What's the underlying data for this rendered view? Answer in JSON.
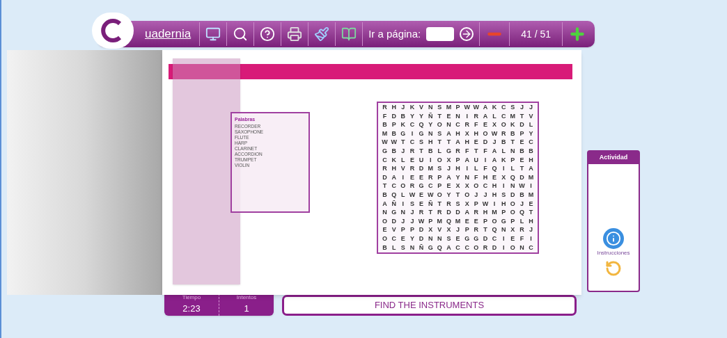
{
  "toolbar": {
    "logo": "uadernia",
    "goto_label": "Ir a página:",
    "page_indicator": "41 / 51"
  },
  "words_panel": {
    "title": "Palabras",
    "words": [
      "RECORDER",
      "SAXOPHONE",
      "FLUTE",
      "HARP",
      "CLARINET",
      "ACCORDION",
      "TRUMPET",
      "VIOLIN"
    ]
  },
  "grid": [
    [
      "R",
      "H",
      "J",
      "K",
      "V",
      "N",
      "S",
      "M",
      "P",
      "W",
      "W",
      "A",
      "K",
      "C",
      "S",
      "J",
      "J"
    ],
    [
      "F",
      "D",
      "B",
      "Y",
      "Y",
      "Ñ",
      "T",
      "E",
      "N",
      "I",
      "R",
      "A",
      "L",
      "C",
      "M",
      "T",
      "V"
    ],
    [
      "B",
      "P",
      "K",
      "C",
      "Q",
      "Y",
      "O",
      "N",
      "C",
      "R",
      "F",
      "E",
      "X",
      "O",
      "K",
      "D",
      "L"
    ],
    [
      "M",
      "B",
      "G",
      "I",
      "G",
      "N",
      "S",
      "A",
      "H",
      "X",
      "H",
      "O",
      "W",
      "R",
      "B",
      "P",
      "Y"
    ],
    [
      "W",
      "W",
      "T",
      "C",
      "S",
      "H",
      "T",
      "T",
      "A",
      "H",
      "E",
      "D",
      "J",
      "B",
      "T",
      "E",
      "C"
    ],
    [
      "G",
      "B",
      "J",
      "R",
      "T",
      "B",
      "L",
      "G",
      "R",
      "F",
      "T",
      "F",
      "A",
      "L",
      "N",
      "B",
      "B"
    ],
    [
      "C",
      "K",
      "L",
      "E",
      "U",
      "I",
      "O",
      "X",
      "P",
      "A",
      "U",
      "I",
      "A",
      "K",
      "P",
      "E",
      "H"
    ],
    [
      "R",
      "H",
      "V",
      "R",
      "D",
      "M",
      "S",
      "J",
      "H",
      "I",
      "L",
      "F",
      "Q",
      "I",
      "L",
      "T",
      "A"
    ],
    [
      "D",
      "A",
      "I",
      "E",
      "E",
      "R",
      "P",
      "A",
      "Y",
      "N",
      "F",
      "H",
      "E",
      "X",
      "Q",
      "D",
      "M"
    ],
    [
      "T",
      "C",
      "O",
      "R",
      "G",
      "C",
      "P",
      "E",
      "X",
      "X",
      "O",
      "C",
      "H",
      "I",
      "N",
      "W",
      "I"
    ],
    [
      "B",
      "Q",
      "L",
      "W",
      "E",
      "W",
      "O",
      "Y",
      "T",
      "O",
      "J",
      "J",
      "H",
      "S",
      "D",
      "B",
      "M"
    ],
    [
      "A",
      "Ñ",
      "I",
      "S",
      "E",
      "Ñ",
      "T",
      "R",
      "S",
      "X",
      "P",
      "W",
      "I",
      "H",
      "O",
      "J",
      "E"
    ],
    [
      "N",
      "G",
      "N",
      "J",
      "R",
      "T",
      "R",
      "D",
      "D",
      "A",
      "R",
      "H",
      "M",
      "P",
      "O",
      "Q",
      "T"
    ],
    [
      "O",
      "D",
      "J",
      "J",
      "W",
      "P",
      "M",
      "Q",
      "M",
      "E",
      "E",
      "P",
      "O",
      "G",
      "P",
      "L",
      "H"
    ],
    [
      "E",
      "V",
      "P",
      "P",
      "D",
      "X",
      "V",
      "X",
      "J",
      "P",
      "R",
      "T",
      "Q",
      "N",
      "X",
      "R",
      "J"
    ],
    [
      "O",
      "C",
      "E",
      "Y",
      "D",
      "N",
      "N",
      "S",
      "E",
      "G",
      "G",
      "D",
      "C",
      "I",
      "E",
      "F",
      "I"
    ],
    [
      "B",
      "L",
      "S",
      "N",
      "Ñ",
      "G",
      "Q",
      "A",
      "C",
      "C",
      "O",
      "R",
      "D",
      "I",
      "O",
      "N",
      "C"
    ]
  ],
  "activity_panel": {
    "title": "Actividad",
    "instructions_label": "Instrucciones"
  },
  "stats": [
    {
      "label": "Tiempo",
      "value": "2:23"
    },
    {
      "label": "Intentos",
      "value": "1"
    }
  ],
  "instruction": "FIND THE INSTRUMENTS"
}
